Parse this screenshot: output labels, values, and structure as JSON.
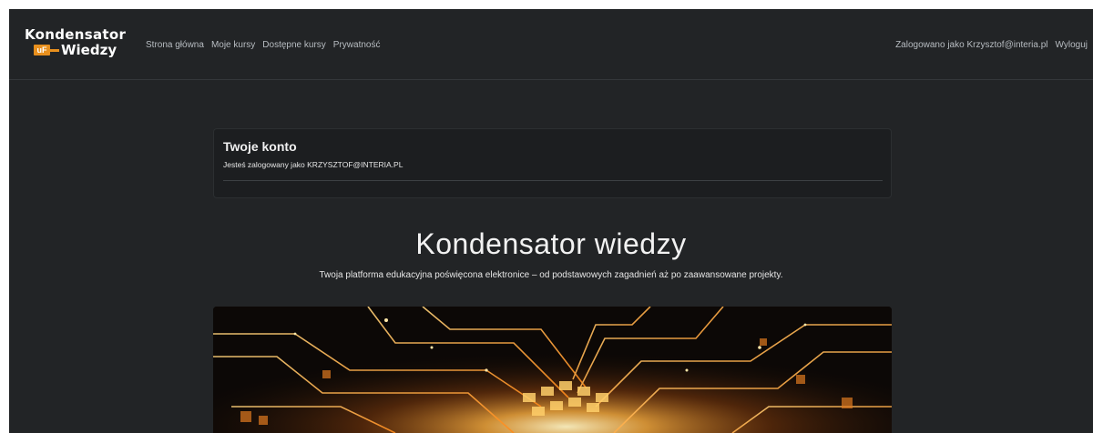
{
  "brand": {
    "name_top": "Kondensator",
    "badge": "uF",
    "name_bottom": "Wiedzy"
  },
  "nav": {
    "links": [
      "Strona główna",
      "Moje kursy",
      "Dostępne kursy",
      "Prywatność"
    ],
    "user_text": "Zalogowano jako Krzysztof@interia.pl",
    "logout": "Wyloguj"
  },
  "account": {
    "title": "Twoje konto",
    "text": "Jesteś zalogowany jako KRZYSZTOF@INTERIA.PL"
  },
  "hero": {
    "title": "Kondensator wiedzy",
    "subtitle": "Twoja platforma edukacyjna poświęcona elektronice – od podstawowych zagadnień aż po zaawansowane projekty."
  },
  "colors": {
    "background": "#222426",
    "accent": "#e8901e",
    "card": "#1c1e20"
  }
}
